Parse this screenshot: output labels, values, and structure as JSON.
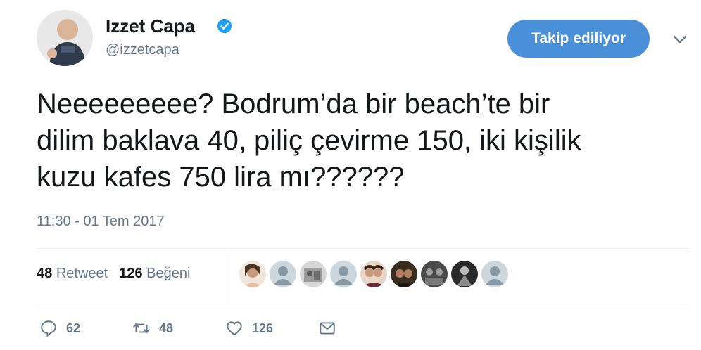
{
  "user": {
    "name": "Izzet Capa",
    "handle": "@izzetcapa"
  },
  "follow_button": {
    "label": "Takip ediliyor"
  },
  "tweet": {
    "text": "Neeeeeeeee? Bodrum’da bir beach’te bir\ndilim baklava 40, piliç çevirme 150, iki kişilik\nkuzu kafes 750 lira mı??????",
    "timestamp": "11:30 - 01 Tem 2017"
  },
  "stats": {
    "retweets": {
      "count": "48",
      "label": "Retweet"
    },
    "likes": {
      "count": "126",
      "label": "Beğeni"
    }
  },
  "likers": [
    {
      "icon": "user-photo"
    },
    {
      "icon": "default-avatar-icon"
    },
    {
      "icon": "user-photo"
    },
    {
      "icon": "default-avatar-icon"
    },
    {
      "icon": "user-photo"
    },
    {
      "icon": "user-photo"
    },
    {
      "icon": "user-photo"
    },
    {
      "icon": "user-photo"
    },
    {
      "icon": "default-avatar-icon"
    }
  ],
  "actions": {
    "reply": {
      "count": "62",
      "icon": "reply-icon"
    },
    "retweet": {
      "count": "48",
      "icon": "retweet-icon"
    },
    "like": {
      "count": "126",
      "icon": "heart-icon"
    },
    "dm": {
      "icon": "mail-icon"
    }
  },
  "colors": {
    "accent": "#4a90d9",
    "verified": "#1da1f2",
    "secondary_text": "#657786"
  }
}
